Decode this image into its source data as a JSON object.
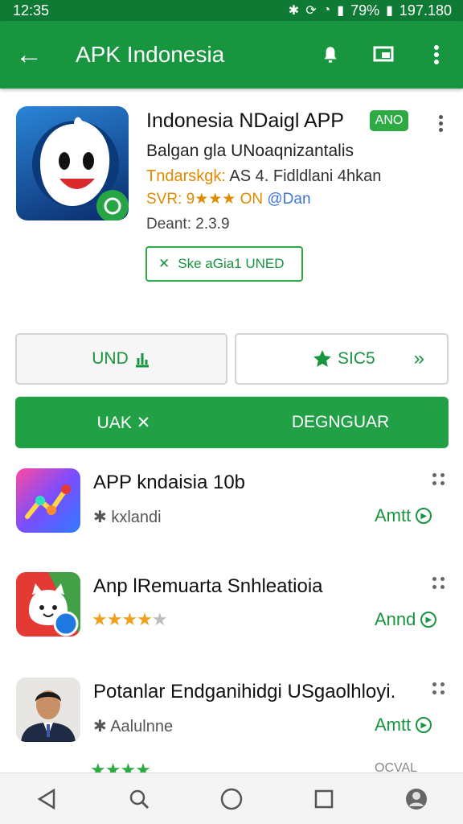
{
  "status_bar": {
    "time": "12:35",
    "battery_pct": "79%",
    "right_value": "197.180"
  },
  "app_bar": {
    "title": "APK Indonesia"
  },
  "header": {
    "app_name": "Indonesia NDaigl APP",
    "badge": "ANO",
    "line1": "Balgan gla UNoaqnizantalis",
    "line2_highlight": "Tndarskgk:",
    "line2_rest": " AS 4. Fidldlani 4hkan",
    "line3_prefix": "SVR: 9",
    "stars": "★★★",
    "line3_on": " ON ",
    "line3_at": "@Dan",
    "line4": "Deant: 2.3.9",
    "chip_label": "Ske aGia1 UNED"
  },
  "buttons": {
    "left_label": "UND",
    "right_label": "SIC5",
    "primary_left": "UAK",
    "primary_right": "DEGNGUAR"
  },
  "list": [
    {
      "name": "APP kndaisia   10b",
      "sub": "kxlandi",
      "action": "Amtt"
    },
    {
      "name": "Anp lRemuarta Snhleatioia",
      "stars_on": "★★★★",
      "stars_off": "★",
      "action": "Annd"
    },
    {
      "name": "Potanlar Endganihidgi USgaolhloyi.",
      "sub": "Aalulnne",
      "action": "Amtt"
    }
  ],
  "peek": {
    "stars": "★★★★",
    "right": "OCVAL"
  },
  "colors": {
    "primary": "#17953f",
    "status": "#0f7a34",
    "accent": "#2eaa45",
    "star": "#f0a01e",
    "link_blue": "#3c74d8"
  }
}
